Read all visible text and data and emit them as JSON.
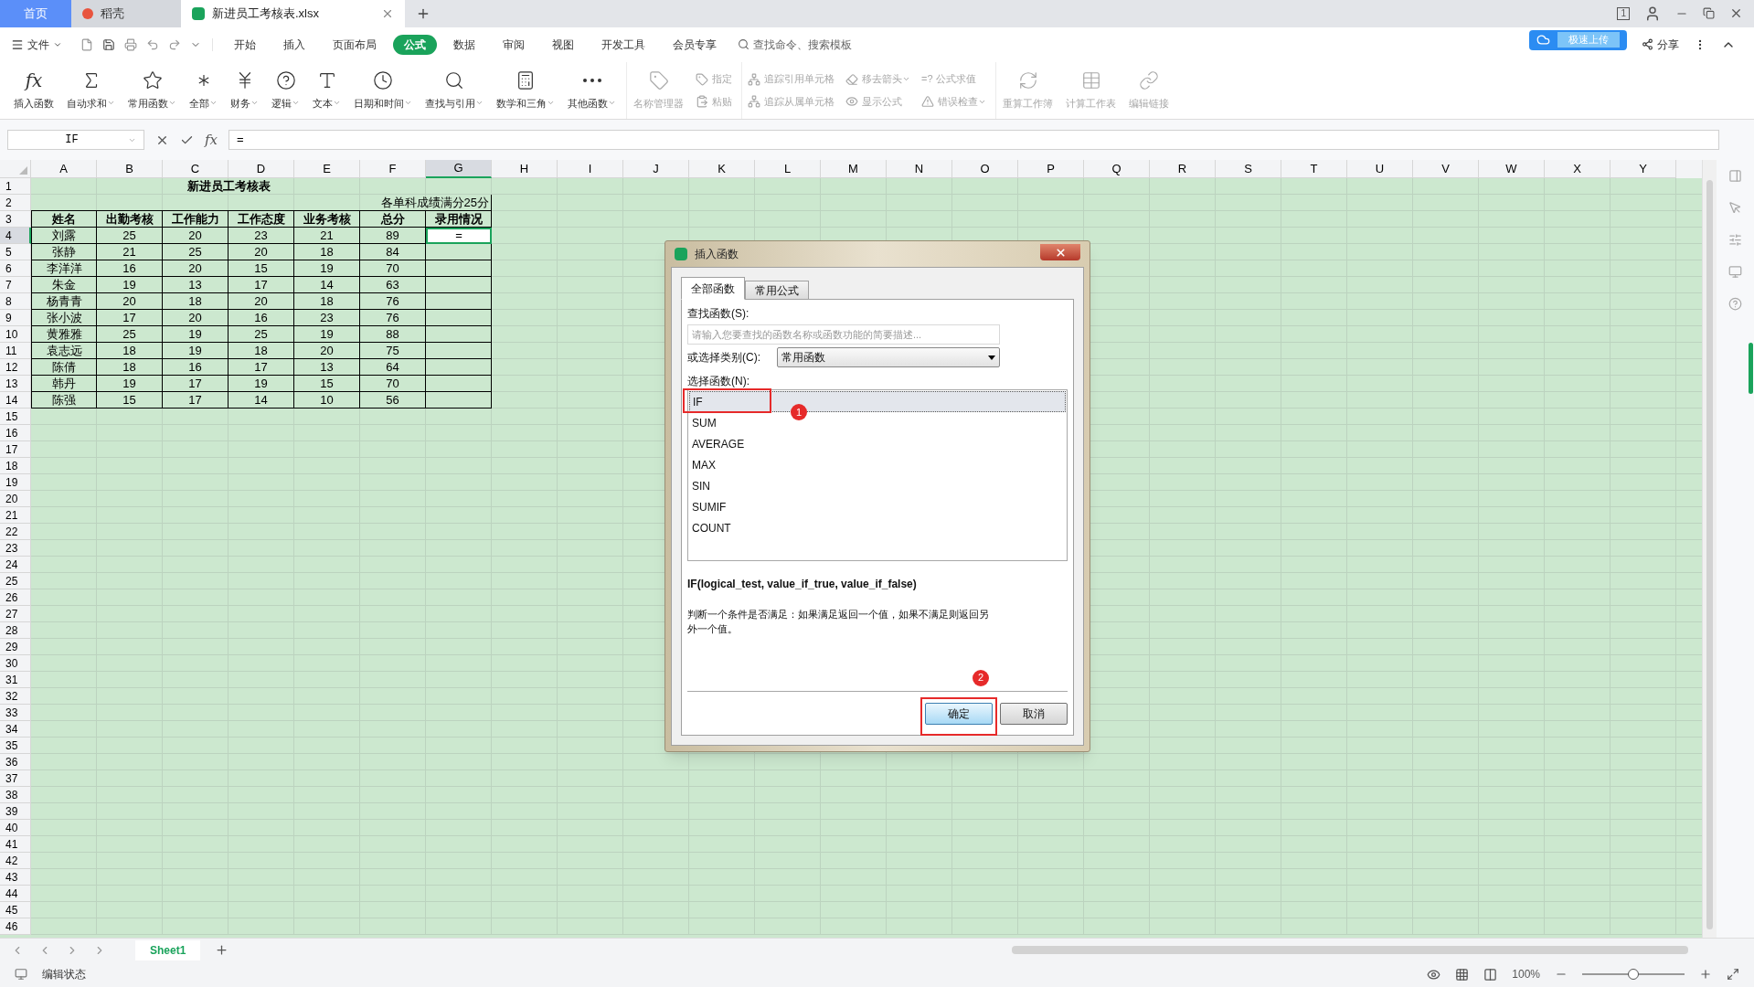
{
  "tabs": [
    {
      "label": "首页",
      "selected": false,
      "kind": "home"
    },
    {
      "label": "稻壳",
      "selected": false,
      "kind": "docer"
    },
    {
      "label": "新进员工考核表.xlsx",
      "selected": true,
      "kind": "sheet"
    }
  ],
  "window_badge": "1",
  "menu": {
    "file": "文件",
    "items": [
      {
        "label": "开始",
        "selected": false
      },
      {
        "label": "插入",
        "selected": false
      },
      {
        "label": "页面布局",
        "selected": false
      },
      {
        "label": "公式",
        "selected": true
      },
      {
        "label": "数据",
        "selected": false
      },
      {
        "label": "审阅",
        "selected": false
      },
      {
        "label": "视图",
        "selected": false
      },
      {
        "label": "开发工具",
        "selected": false
      },
      {
        "label": "会员专享",
        "selected": false
      }
    ],
    "search": "查找命令、搜索模板",
    "upload": "极速上传",
    "share": "分享"
  },
  "ribbon": [
    {
      "kind": "large",
      "glyph": "fx",
      "label": "插入函数",
      "dropdown": false,
      "disabled": false
    },
    {
      "kind": "large",
      "label": "自动求和",
      "dropdown": true,
      "disabled": false
    },
    {
      "kind": "large",
      "label": "常用函数",
      "dropdown": true,
      "disabled": false
    },
    {
      "kind": "large",
      "label": "全部",
      "dropdown": true,
      "disabled": false
    },
    {
      "kind": "large",
      "label": "财务",
      "dropdown": true,
      "disabled": false
    },
    {
      "kind": "large",
      "label": "逻辑",
      "dropdown": true,
      "disabled": false
    },
    {
      "kind": "large",
      "label": "文本",
      "dropdown": true,
      "disabled": false
    },
    {
      "kind": "large",
      "label": "日期和时间",
      "dropdown": true,
      "disabled": false
    },
    {
      "kind": "large",
      "label": "查找与引用",
      "dropdown": true,
      "disabled": false
    },
    {
      "kind": "large",
      "label": "数学和三角",
      "dropdown": true,
      "disabled": false
    },
    {
      "kind": "large",
      "label": "其他函数",
      "dropdown": true,
      "disabled": false
    },
    {
      "kind": "large",
      "label": "名称管理器",
      "dropdown": false,
      "disabled": true
    },
    {
      "kind": "stack",
      "items": [
        {
          "label": "指定",
          "dropdown": false,
          "disabled": true
        },
        {
          "label": "粘贴",
          "dropdown": false,
          "disabled": true
        }
      ]
    },
    {
      "kind": "stack",
      "items": [
        {
          "label": "追踪引用单元格",
          "dropdown": false,
          "disabled": true
        },
        {
          "label": "追踪从属单元格",
          "dropdown": false,
          "disabled": true
        }
      ]
    },
    {
      "kind": "stack",
      "items": [
        {
          "label": "移去箭头",
          "dropdown": true,
          "disabled": true
        },
        {
          "label": "显示公式",
          "dropdown": false,
          "disabled": true
        }
      ]
    },
    {
      "kind": "stack",
      "items": [
        {
          "label": "=? 公式求值",
          "dropdown": false,
          "disabled": true
        },
        {
          "label": "错误检查",
          "dropdown": true,
          "disabled": true
        }
      ]
    },
    {
      "kind": "large",
      "label": "重算工作簿",
      "dropdown": false,
      "disabled": true
    },
    {
      "kind": "large",
      "label": "计算工作表",
      "dropdown": false,
      "disabled": true
    },
    {
      "kind": "large",
      "label": "编辑链接",
      "dropdown": false,
      "disabled": true
    }
  ],
  "formula_bar": {
    "name_box": "IF",
    "fx": "fx",
    "value": "="
  },
  "sheet": {
    "columns": [
      {
        "label": "A",
        "selected": false
      },
      {
        "label": "B",
        "selected": false
      },
      {
        "label": "C",
        "selected": false
      },
      {
        "label": "D",
        "selected": false
      },
      {
        "label": "E",
        "selected": false
      },
      {
        "label": "F",
        "selected": false
      },
      {
        "label": "G",
        "selected": true
      },
      {
        "label": "H",
        "selected": false
      },
      {
        "label": "I",
        "selected": false
      },
      {
        "label": "J",
        "selected": false
      },
      {
        "label": "K",
        "selected": false
      },
      {
        "label": "L",
        "selected": false
      },
      {
        "label": "M",
        "selected": false
      },
      {
        "label": "N",
        "selected": false
      },
      {
        "label": "O",
        "selected": false
      },
      {
        "label": "P",
        "selected": false
      },
      {
        "label": "Q",
        "selected": false
      },
      {
        "label": "R",
        "selected": false
      },
      {
        "label": "S",
        "selected": false
      },
      {
        "label": "T",
        "selected": false
      },
      {
        "label": "U",
        "selected": false
      },
      {
        "label": "V",
        "selected": false
      },
      {
        "label": "W",
        "selected": false
      },
      {
        "label": "X",
        "selected": false
      },
      {
        "label": "Y",
        "selected": false
      }
    ],
    "rows": [
      {
        "label": "1",
        "selected": false
      },
      {
        "label": "2",
        "selected": false
      },
      {
        "label": "3",
        "selected": false
      },
      {
        "label": "4",
        "selected": true
      },
      {
        "label": "5",
        "selected": false
      },
      {
        "label": "6",
        "selected": false
      },
      {
        "label": "7",
        "selected": false
      },
      {
        "label": "8",
        "selected": false
      },
      {
        "label": "9",
        "selected": false
      },
      {
        "label": "10",
        "selected": false
      },
      {
        "label": "11",
        "selected": false
      },
      {
        "label": "12",
        "selected": false
      },
      {
        "label": "13",
        "selected": false
      },
      {
        "label": "14",
        "selected": false
      },
      {
        "label": "15",
        "selected": false
      },
      {
        "label": "16",
        "selected": false
      },
      {
        "label": "17",
        "selected": false
      },
      {
        "label": "18",
        "selected": false
      },
      {
        "label": "19",
        "selected": false
      },
      {
        "label": "20",
        "selected": false
      },
      {
        "label": "21",
        "selected": false
      },
      {
        "label": "22",
        "selected": false
      },
      {
        "label": "23",
        "selected": false
      },
      {
        "label": "24",
        "selected": false
      },
      {
        "label": "25",
        "selected": false
      },
      {
        "label": "26",
        "selected": false
      },
      {
        "label": "27",
        "selected": false
      },
      {
        "label": "28",
        "selected": false
      },
      {
        "label": "29",
        "selected": false
      },
      {
        "label": "30",
        "selected": false
      },
      {
        "label": "31",
        "selected": false
      },
      {
        "label": "32",
        "selected": false
      },
      {
        "label": "33",
        "selected": false
      },
      {
        "label": "34",
        "selected": false
      },
      {
        "label": "35",
        "selected": false
      },
      {
        "label": "36",
        "selected": false
      },
      {
        "label": "37",
        "selected": false
      },
      {
        "label": "38",
        "selected": false
      },
      {
        "label": "39",
        "selected": false
      },
      {
        "label": "40",
        "selected": false
      },
      {
        "label": "41",
        "selected": false
      },
      {
        "label": "42",
        "selected": false
      },
      {
        "label": "43",
        "selected": false
      },
      {
        "label": "44",
        "selected": false
      },
      {
        "label": "45",
        "selected": false
      },
      {
        "label": "46",
        "selected": false
      }
    ],
    "title": "新进员工考核表",
    "note": "各单科成绩满分25分",
    "headers": [
      "姓名",
      "出勤考核",
      "工作能力",
      "工作态度",
      "业务考核",
      "总分",
      "录用情况"
    ],
    "records": [
      {
        "cells": [
          "刘露",
          "25",
          "20",
          "23",
          "21",
          "89"
        ],
        "result": "=",
        "active": true
      },
      {
        "cells": [
          "张静",
          "21",
          "25",
          "20",
          "18",
          "84"
        ],
        "active": false
      },
      {
        "cells": [
          "李洋洋",
          "16",
          "20",
          "15",
          "19",
          "70"
        ],
        "active": false
      },
      {
        "cells": [
          "朱金",
          "19",
          "13",
          "17",
          "14",
          "63"
        ],
        "active": false
      },
      {
        "cells": [
          "杨青青",
          "20",
          "18",
          "20",
          "18",
          "76"
        ],
        "active": false
      },
      {
        "cells": [
          "张小波",
          "17",
          "20",
          "16",
          "23",
          "76"
        ],
        "active": false
      },
      {
        "cells": [
          "黄雅雅",
          "25",
          "19",
          "25",
          "19",
          "88"
        ],
        "active": false
      },
      {
        "cells": [
          "袁志远",
          "18",
          "19",
          "18",
          "20",
          "75"
        ],
        "active": false
      },
      {
        "cells": [
          "陈倩",
          "18",
          "16",
          "17",
          "13",
          "64"
        ],
        "active": false
      },
      {
        "cells": [
          "韩丹",
          "19",
          "17",
          "19",
          "15",
          "70"
        ],
        "active": false
      },
      {
        "cells": [
          "陈强",
          "15",
          "17",
          "14",
          "10",
          "56"
        ],
        "active": false
      }
    ]
  },
  "dialog": {
    "title": "插入函数",
    "tabs": [
      {
        "label": "全部函数",
        "selected": true
      },
      {
        "label": "常用公式",
        "selected": false
      }
    ],
    "search_label": "查找函数(S):",
    "search_placeholder": "请输入您要查找的函数名称或函数功能的简要描述...",
    "category_label": "或选择类别(C):",
    "category": "常用函数",
    "list_label": "选择函数(N):",
    "functions": [
      {
        "label": "IF",
        "selected": true
      },
      {
        "label": "SUM",
        "selected": false
      },
      {
        "label": "AVERAGE",
        "selected": false
      },
      {
        "label": "MAX",
        "selected": false
      },
      {
        "label": "SIN",
        "selected": false
      },
      {
        "label": "SUMIF",
        "selected": false
      },
      {
        "label": "COUNT",
        "selected": false
      }
    ],
    "signature": "IF(logical_test, value_if_true, value_if_false)",
    "description": "判断一个条件是否满足：如果满足返回一个值，如果不满足则返回另外一个值。",
    "buttons": [
      {
        "label": "确定",
        "kind": "primary"
      },
      {
        "label": "取消",
        "kind": "secondary"
      }
    ],
    "callouts": [
      "1",
      "2"
    ]
  },
  "sheet_tabs": [
    {
      "label": "Sheet1",
      "selected": true
    }
  ],
  "status": {
    "text": "编辑状态",
    "zoom": "100%",
    "zoom_slider": {
      "level": 0.5
    }
  }
}
